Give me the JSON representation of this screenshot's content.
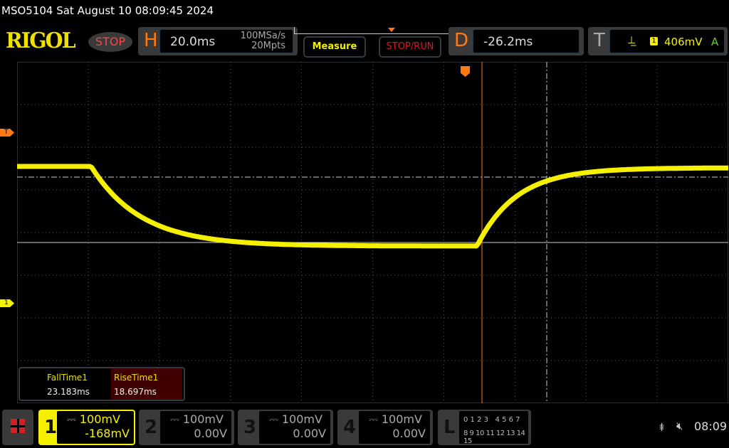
{
  "title": "MSO5104  Sat August 10 08:09:45 2024",
  "logo": "RIGOL",
  "run_state": "STOP",
  "horizontal": {
    "letter": "H",
    "timebase": "20.0ms",
    "sample_rate": "100MSa/s",
    "memory_depth": "20Mpts"
  },
  "buttons": {
    "measure": "Measure",
    "stop_run": "STOP/RUN"
  },
  "delay": {
    "letter": "D",
    "value": "-26.2ms"
  },
  "trigger": {
    "letter": "T",
    "source": "1",
    "level": "406mV",
    "mode": "A",
    "slope_icon": "rising-edge-icon"
  },
  "markers": {
    "trigger_level": "T",
    "channel1": "1"
  },
  "measurements": [
    {
      "label": "FallTime1",
      "value": "23.183ms"
    },
    {
      "label": "RiseTime1",
      "value": "18.697ms"
    }
  ],
  "channels": [
    {
      "num": "1",
      "scale": "100mV",
      "offset": "-168mV",
      "active": true
    },
    {
      "num": "2",
      "scale": "100mV",
      "offset": "0.00V",
      "active": false
    },
    {
      "num": "3",
      "scale": "100mV",
      "offset": "0.00V",
      "active": false
    },
    {
      "num": "4",
      "scale": "100mV",
      "offset": "0.00V",
      "active": false
    }
  ],
  "logic": {
    "letter": "L",
    "row1": "0 1 2 3   4 5 6 7",
    "row2": "8 9 10 11 12 13 14 15"
  },
  "status": {
    "time": "08:09"
  },
  "colors": {
    "ch1": "#f5f000",
    "orange": "#ff7a10"
  }
}
